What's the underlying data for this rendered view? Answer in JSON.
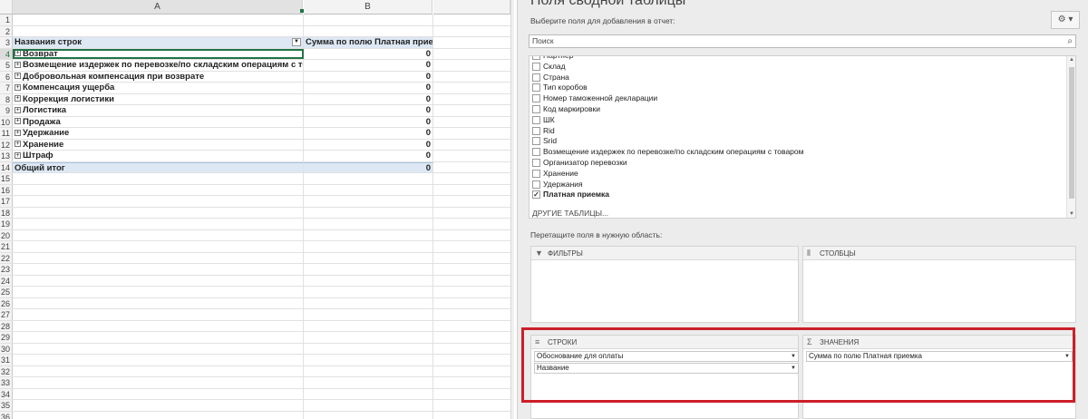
{
  "sheet": {
    "columns": [
      "A",
      "B"
    ],
    "header_row": {
      "row": "3",
      "a": "Названия строк",
      "b": "Сумма по полю Платная приемка"
    },
    "row_numbers": [
      "1",
      "2",
      "3",
      "4",
      "5",
      "6",
      "7",
      "8",
      "9",
      "10",
      "11",
      "12",
      "13",
      "14",
      "15",
      "16",
      "17",
      "18",
      "19",
      "20",
      "21",
      "22",
      "23",
      "24",
      "25",
      "26",
      "27",
      "28",
      "29",
      "30",
      "31",
      "32",
      "33",
      "34",
      "35",
      "36"
    ],
    "items": [
      {
        "row": "4",
        "label": "Возврат",
        "value": "0"
      },
      {
        "row": "5",
        "label": "Возмещение издержек по перевозке/по складским операциям с товаром",
        "value": "0"
      },
      {
        "row": "6",
        "label": "Добровольная компенсация при возврате",
        "value": "0"
      },
      {
        "row": "7",
        "label": "Компенсация ущерба",
        "value": "0"
      },
      {
        "row": "8",
        "label": "Коррекция логистики",
        "value": "0"
      },
      {
        "row": "9",
        "label": "Логистика",
        "value": "0"
      },
      {
        "row": "10",
        "label": "Продажа",
        "value": "0"
      },
      {
        "row": "11",
        "label": "Удержание",
        "value": "0"
      },
      {
        "row": "12",
        "label": "Хранение",
        "value": "0"
      },
      {
        "row": "13",
        "label": "Штраф",
        "value": "0"
      }
    ],
    "total": {
      "row": "14",
      "label": "Общий итог",
      "value": "0"
    }
  },
  "pane": {
    "title": "Поля сводной таблицы",
    "subtitle": "Выберите поля для добавления в отчет:",
    "search_placeholder": "Поиск",
    "fields": [
      {
        "label": "Партнер",
        "checked": false
      },
      {
        "label": "Склад",
        "checked": false
      },
      {
        "label": "Страна",
        "checked": false
      },
      {
        "label": "Тип коробов",
        "checked": false
      },
      {
        "label": "Номер таможенной декларации",
        "checked": false
      },
      {
        "label": "Код маркировки",
        "checked": false
      },
      {
        "label": "ШК",
        "checked": false
      },
      {
        "label": "Rid",
        "checked": false
      },
      {
        "label": "Srid",
        "checked": false
      },
      {
        "label": "Возмещение издержек по перевозке/по складским операциям с товаром",
        "checked": false
      },
      {
        "label": "Организатор перевозки",
        "checked": false
      },
      {
        "label": "Хранение",
        "checked": false
      },
      {
        "label": "Удержания",
        "checked": false
      },
      {
        "label": "Платная приемка",
        "checked": true
      }
    ],
    "other_tables": "ДРУГИЕ ТАБЛИЦЫ...",
    "drag_hint": "Перетащите поля в нужную область:",
    "filters_label": "ФИЛЬТРЫ",
    "columns_label": "СТОЛБЦЫ",
    "rows_label": "СТРОКИ",
    "values_label": "ЗНАЧЕНИЯ",
    "rows_fields": [
      "Обоснование для оплаты",
      "Название"
    ],
    "values_fields": [
      "Сумма по полю Платная приемка"
    ]
  },
  "colors": {
    "highlight": "#cc1f2a",
    "excel_green": "#217346",
    "pivot_header": "#dde8f4"
  }
}
